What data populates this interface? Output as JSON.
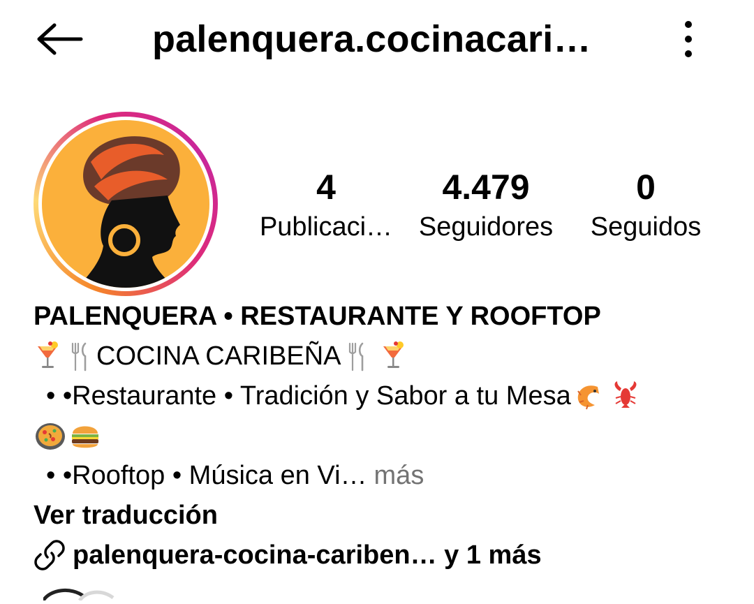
{
  "header": {
    "username": "palenquera.cocinacari…",
    "back_icon": "arrow-left-icon",
    "menu_icon": "more-vertical-icon"
  },
  "stats": [
    {
      "value": "4",
      "label": "Publicaci…"
    },
    {
      "value": "4.479",
      "label": "Seguidores"
    },
    {
      "value": "0",
      "label": "Seguidos"
    }
  ],
  "bio": {
    "name": "PALENQUERA • RESTAURANTE Y ROOFTOP",
    "line1_text": "COCINA CARIBEÑA",
    "line2_text": "• •Restaurante • Tradición y Sabor a tu Mesa",
    "line4_text": "• •Rooftop • Música en Vi…",
    "more": "más",
    "translate": "Ver traducción",
    "link_text": "palenquera-cocina-cariben… y 1 más"
  },
  "colors": {
    "ring_start": "#f58529",
    "ring_mid": "#dd2a7b",
    "more_gray": "#737373",
    "avatar_bg": "#fbb03b"
  }
}
